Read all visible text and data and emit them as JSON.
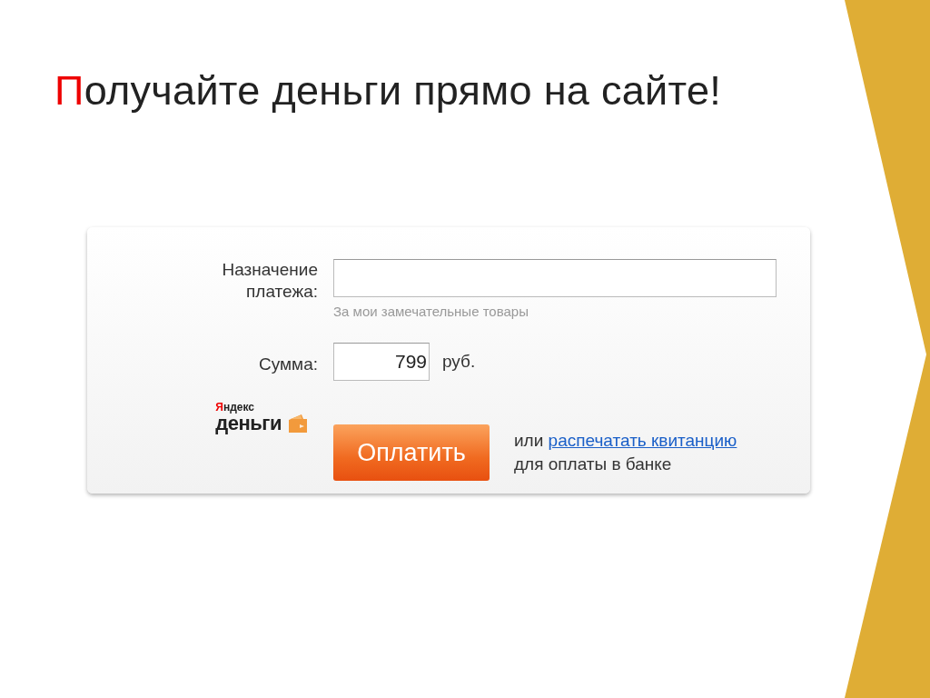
{
  "title": "Получайте деньги прямо на сайте!",
  "form": {
    "purpose": {
      "label": "Назначение платежа:",
      "placeholder": "За мои замечательные товары"
    },
    "amount": {
      "label": "Сумма:",
      "value": "799",
      "unit": "руб."
    },
    "logo": {
      "top": "Яндекс",
      "bottom": "деньги"
    },
    "pay_button": "Оплатить",
    "alt_prefix": "или",
    "alt_link": "распечатать квитанцию",
    "alt_suffix": "для оплаты в банке"
  }
}
